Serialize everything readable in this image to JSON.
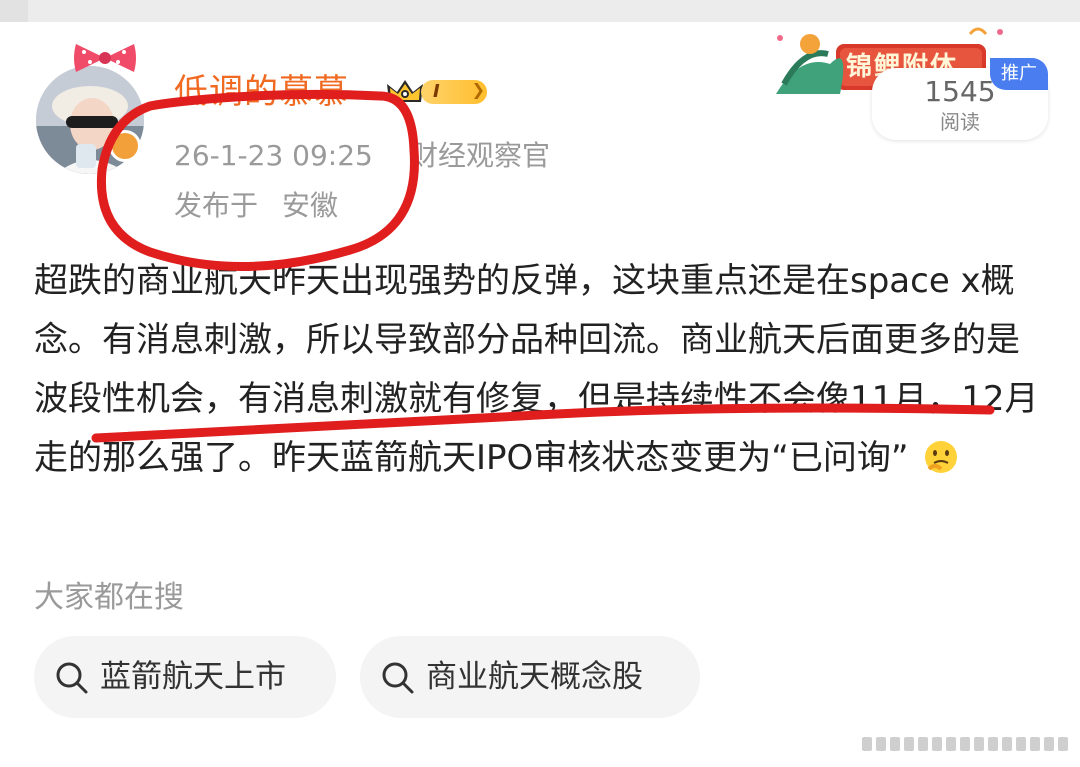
{
  "post": {
    "username": "低调的慕慕",
    "vip_level": "I",
    "timestamp": "26-1-23 09:25",
    "category": "财经观察官",
    "location_label": "发布于",
    "location": "安徽",
    "content": "超跌的商业航天昨天出现强势的反弹，这块重点还是在space x概念。有消息刺激，所以导致部分品种回流。商业航天后面更多的是波段性机会，有消息刺激就有修复，但是持续性不会像11月，12月走的那么强了。昨天蓝箭航天IPO审核状态变更为“已问询”"
  },
  "ad": {
    "banner_text": "锦鲤附体",
    "tag": "推广",
    "read_count": "1545",
    "read_label": "阅读"
  },
  "search": {
    "heading": "大家都在搜",
    "chips": [
      {
        "label": "蓝箭航天上市"
      },
      {
        "label": "商业航天概念股"
      }
    ]
  },
  "colors": {
    "username": "#f06a22",
    "meta": "#9a9a9a",
    "annotation": "#e01e1e",
    "ad_tag": "#4a7ef0"
  },
  "icons": [
    "crown-icon",
    "search-icon",
    "thinking-emoji-icon",
    "user-avatar"
  ]
}
